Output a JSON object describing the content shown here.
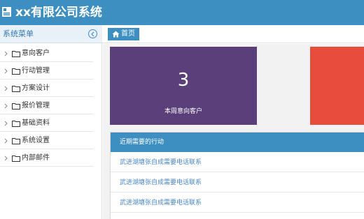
{
  "app": {
    "title": "xx有限公司系统",
    "logo_icon": "document-icon"
  },
  "sidebar": {
    "header_label": "系统菜单",
    "collapse_icon": "chevron-left-circle-icon",
    "items": [
      {
        "label": "意向客户"
      },
      {
        "label": "行动管理"
      },
      {
        "label": "方案设计"
      },
      {
        "label": "报价管理"
      },
      {
        "label": "基础资料"
      },
      {
        "label": "系统设置"
      },
      {
        "label": "内部邮件"
      }
    ]
  },
  "breadcrumb": {
    "home_label": "首页",
    "home_icon": "home-icon"
  },
  "dashboard": {
    "stat_card": {
      "value": "3",
      "label": "本周意向客户",
      "color": "#5a3f7b"
    },
    "second_card_color": "#e74c3c",
    "actions_panel": {
      "title": "近期需要的行动",
      "rows": [
        {
          "text": "武进湖塘张自成需要电话联系"
        },
        {
          "text": "武进湖塘张自成需要电话联系"
        },
        {
          "text": "武进湖塘张自成需要电话联系"
        }
      ]
    }
  },
  "colors": {
    "primary": "#3d8fc2",
    "link": "#4a86c5"
  }
}
